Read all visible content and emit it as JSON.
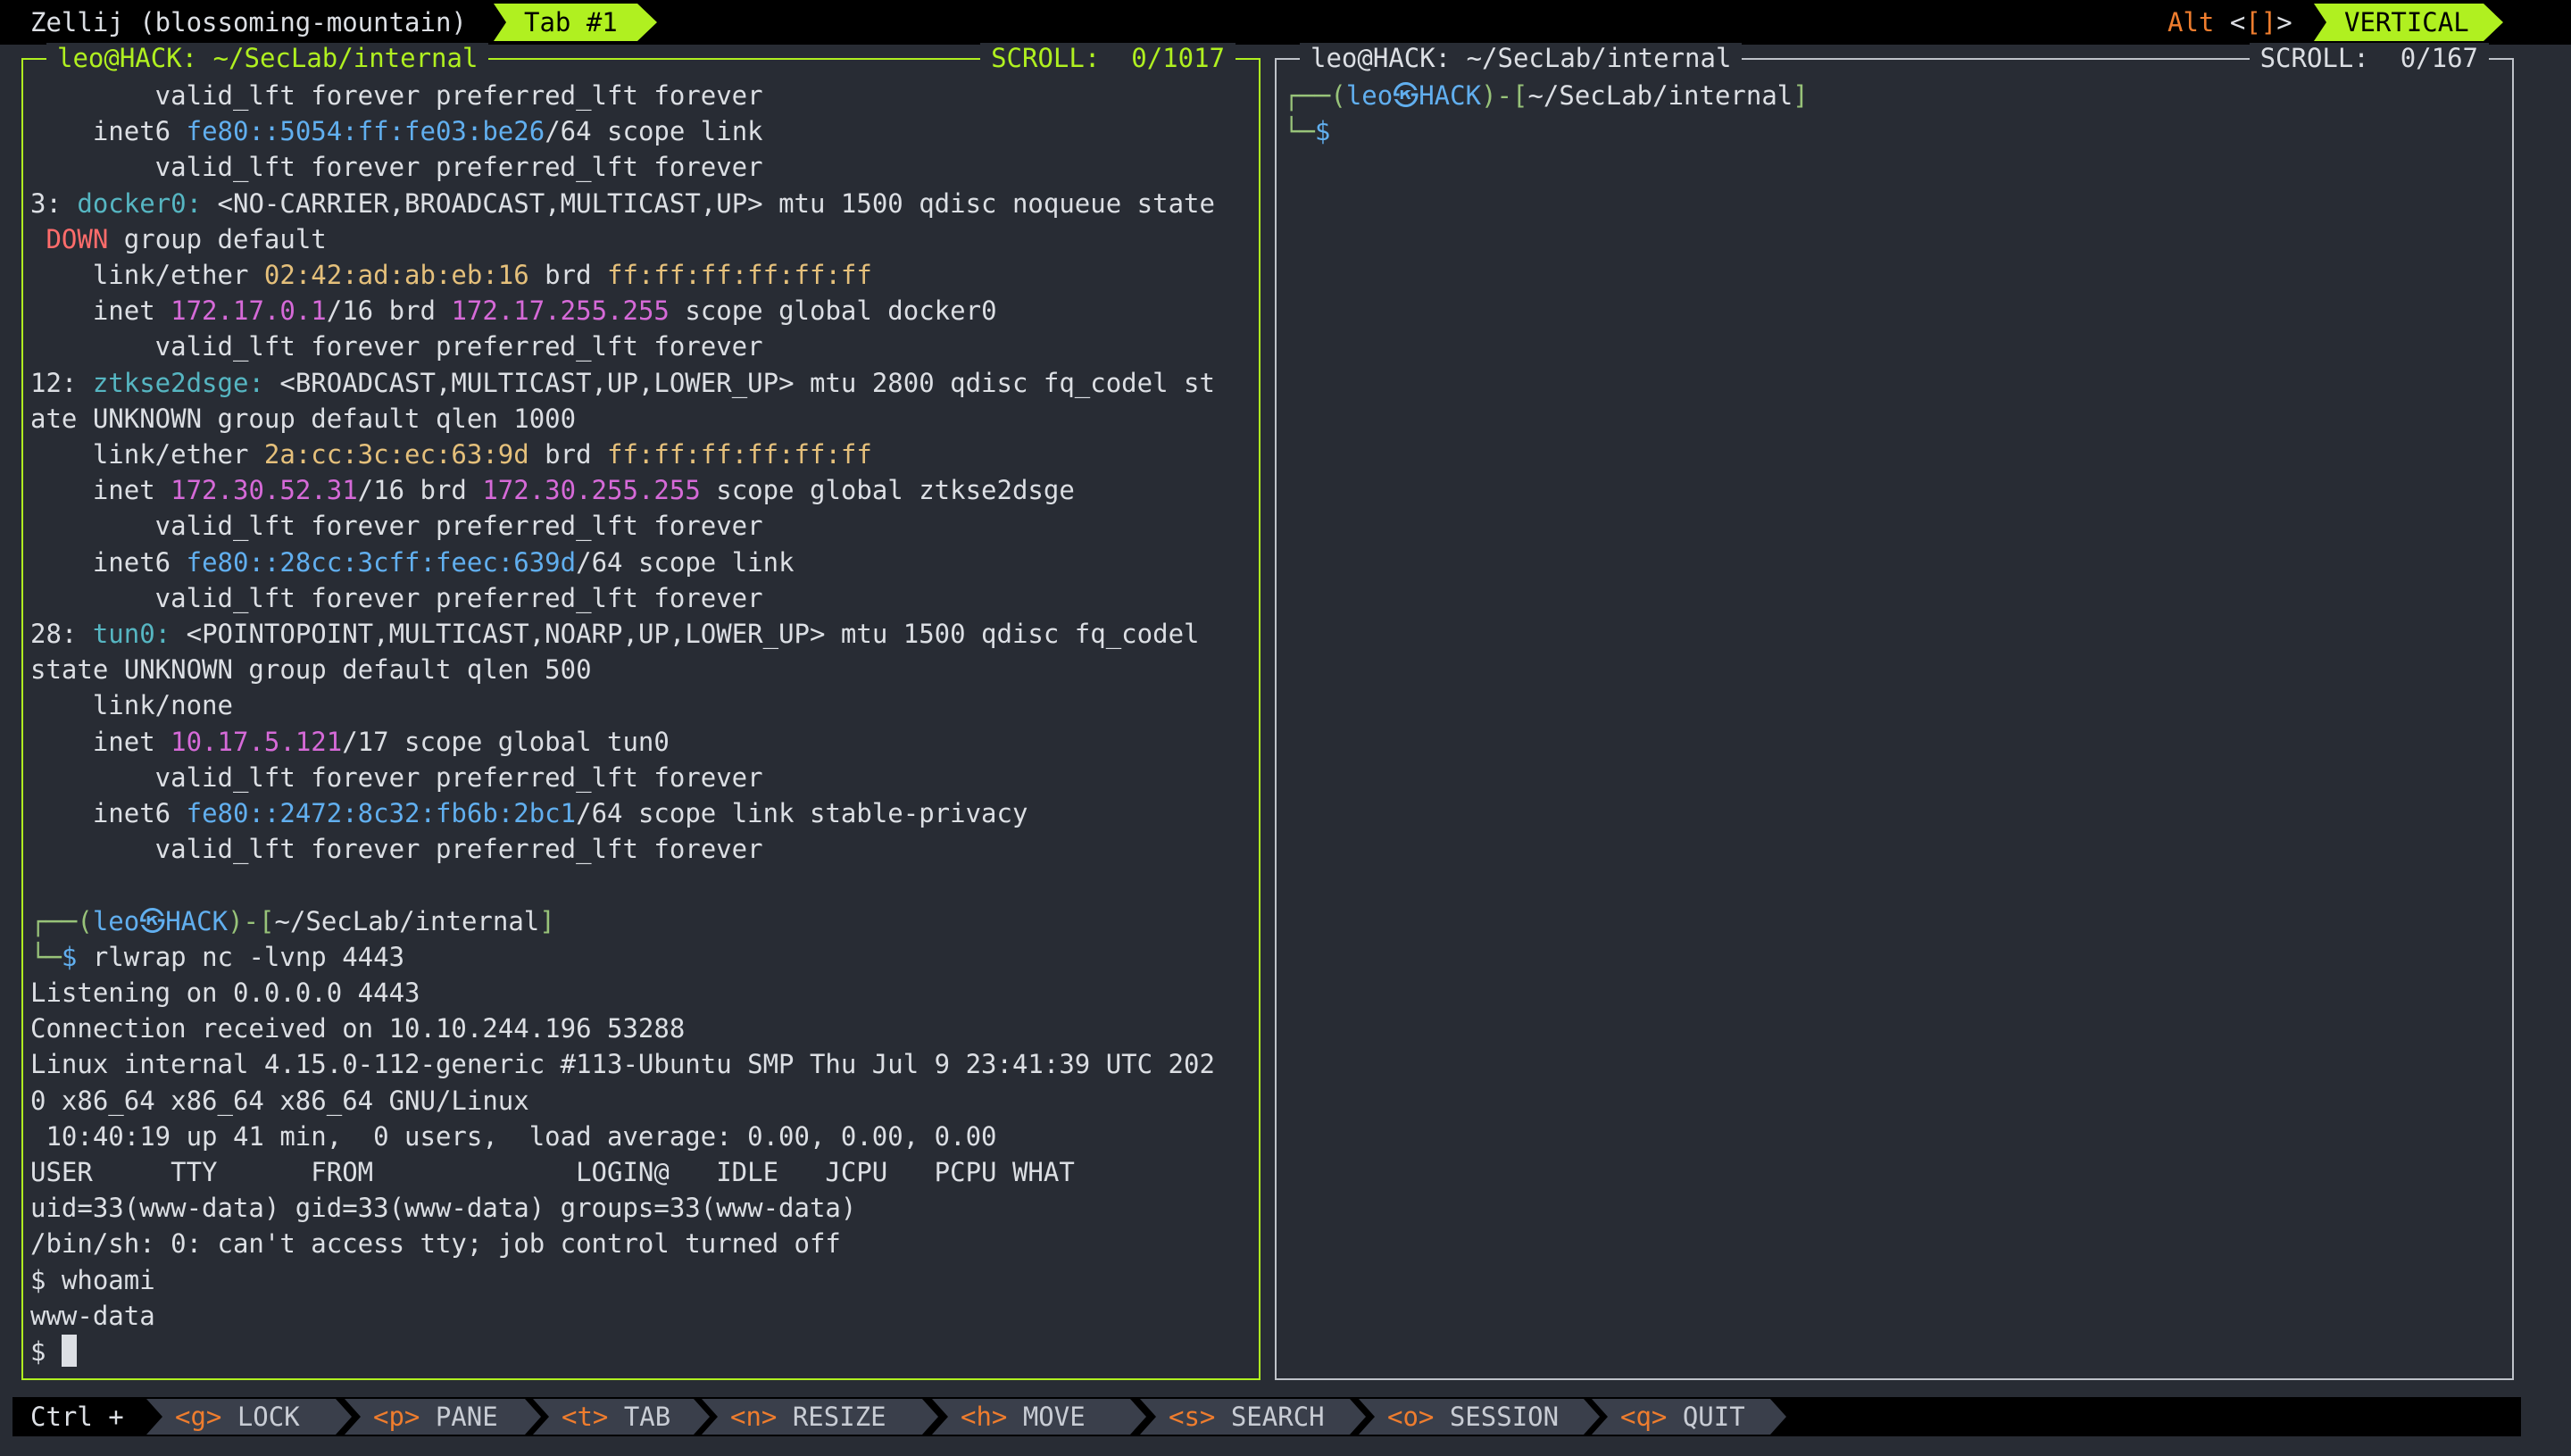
{
  "topbar": {
    "session": "Zellij (blossoming-mountain)",
    "tab": "Tab #1",
    "mode_alt": "Alt",
    "mode_lt": " <",
    "mode_brackets": "[]",
    "mode_gt": ">",
    "layout": "VERTICAL"
  },
  "left_pane": {
    "title": "leo@HACK: ~/SecLab/internal",
    "scroll": "SCROLL:  0/1017",
    "lines": [
      [
        {
          "t": "        valid_lft forever preferred_lft forever"
        }
      ],
      [
        {
          "t": "    inet6 "
        },
        {
          "t": "fe80::5054:ff:fe03:be26",
          "c": "c-blue"
        },
        {
          "t": "/64 scope link"
        }
      ],
      [
        {
          "t": "        valid_lft forever preferred_lft forever"
        }
      ],
      [
        {
          "t": "3: "
        },
        {
          "t": "docker0:",
          "c": "c-cyan"
        },
        {
          "t": " <NO-CARRIER,BROADCAST,MULTICAST,UP> mtu 1500 qdisc noqueue state"
        }
      ],
      [
        {
          "t": " "
        },
        {
          "t": "DOWN",
          "c": "c-red"
        },
        {
          "t": " group default"
        }
      ],
      [
        {
          "t": "    link/ether "
        },
        {
          "t": "02:42:ad:ab:eb:16",
          "c": "c-yel"
        },
        {
          "t": " brd "
        },
        {
          "t": "ff:ff:ff:ff:ff:ff",
          "c": "c-yel"
        }
      ],
      [
        {
          "t": "    inet "
        },
        {
          "t": "172.17.0.1",
          "c": "c-mag"
        },
        {
          "t": "/16 brd "
        },
        {
          "t": "172.17.255.255",
          "c": "c-mag"
        },
        {
          "t": " scope global docker0"
        }
      ],
      [
        {
          "t": "        valid_lft forever preferred_lft forever"
        }
      ],
      [
        {
          "t": "12: "
        },
        {
          "t": "ztkse2dsge:",
          "c": "c-cyan"
        },
        {
          "t": " <BROADCAST,MULTICAST,UP,LOWER_UP> mtu 2800 qdisc fq_codel st"
        }
      ],
      [
        {
          "t": "ate UNKNOWN group default qlen 1000"
        }
      ],
      [
        {
          "t": "    link/ether "
        },
        {
          "t": "2a:cc:3c:ec:63:9d",
          "c": "c-yel"
        },
        {
          "t": " brd "
        },
        {
          "t": "ff:ff:ff:ff:ff:ff",
          "c": "c-yel"
        }
      ],
      [
        {
          "t": "    inet "
        },
        {
          "t": "172.30.52.31",
          "c": "c-mag"
        },
        {
          "t": "/16 brd "
        },
        {
          "t": "172.30.255.255",
          "c": "c-mag"
        },
        {
          "t": " scope global ztkse2dsge"
        }
      ],
      [
        {
          "t": "        valid_lft forever preferred_lft forever"
        }
      ],
      [
        {
          "t": "    inet6 "
        },
        {
          "t": "fe80::28cc:3cff:feec:639d",
          "c": "c-blue"
        },
        {
          "t": "/64 scope link"
        }
      ],
      [
        {
          "t": "        valid_lft forever preferred_lft forever"
        }
      ],
      [
        {
          "t": "28: "
        },
        {
          "t": "tun0:",
          "c": "c-cyan"
        },
        {
          "t": " <POINTOPOINT,MULTICAST,NOARP,UP,LOWER_UP> mtu 1500 qdisc fq_codel"
        }
      ],
      [
        {
          "t": "state UNKNOWN group default qlen 500"
        }
      ],
      [
        {
          "t": "    link/none"
        }
      ],
      [
        {
          "t": "    inet "
        },
        {
          "t": "10.17.5.121",
          "c": "c-mag"
        },
        {
          "t": "/17 scope global tun0"
        }
      ],
      [
        {
          "t": "        valid_lft forever preferred_lft forever"
        }
      ],
      [
        {
          "t": "    inet6 "
        },
        {
          "t": "fe80::2472:8c32:fb6b:2bc1",
          "c": "c-blue"
        },
        {
          "t": "/64 scope link stable-privacy"
        }
      ],
      [
        {
          "t": "        valid_lft forever preferred_lft forever"
        }
      ],
      [
        {
          "t": ""
        }
      ],
      [
        {
          "t": "┌──(",
          "c": "c-green"
        },
        {
          "t": "leo㉿HACK",
          "c": "c-blue"
        },
        {
          "t": ")-[",
          "c": "c-green"
        },
        {
          "t": "~/SecLab/internal"
        },
        {
          "t": "]",
          "c": "c-green"
        }
      ],
      [
        {
          "t": "└─",
          "c": "c-green"
        },
        {
          "t": "$",
          "c": "c-blue"
        },
        {
          "t": " rlwrap nc -lvnp 4443"
        }
      ],
      [
        {
          "t": "Listening on 0.0.0.0 4443"
        }
      ],
      [
        {
          "t": "Connection received on 10.10.244.196 53288"
        }
      ],
      [
        {
          "t": "Linux internal 4.15.0-112-generic #113-Ubuntu SMP Thu Jul 9 23:41:39 UTC 202"
        }
      ],
      [
        {
          "t": "0 x86_64 x86_64 x86_64 GNU/Linux"
        }
      ],
      [
        {
          "t": " 10:40:19 up 41 min,  0 users,  load average: 0.00, 0.00, 0.00"
        }
      ],
      [
        {
          "t": "USER     TTY      FROM             LOGIN@   IDLE   JCPU   PCPU WHAT"
        }
      ],
      [
        {
          "t": "uid=33(www-data) gid=33(www-data) groups=33(www-data)"
        }
      ],
      [
        {
          "t": "/bin/sh: 0: can't access tty; job control turned off"
        }
      ],
      [
        {
          "t": "$ whoami"
        }
      ],
      [
        {
          "t": "www-data"
        }
      ],
      [
        {
          "t": "$ "
        },
        {
          "cursor": true
        }
      ]
    ]
  },
  "right_pane": {
    "title": "leo@HACK: ~/SecLab/internal",
    "scroll": "SCROLL:  0/167",
    "lines": [
      [
        {
          "t": "┌──(",
          "c": "c-green"
        },
        {
          "t": "leo㉿HACK",
          "c": "c-blue"
        },
        {
          "t": ")-[",
          "c": "c-green"
        },
        {
          "t": "~/SecLab/internal"
        },
        {
          "t": "]",
          "c": "c-green"
        }
      ],
      [
        {
          "t": "└─",
          "c": "c-green"
        },
        {
          "t": "$",
          "c": "c-blue"
        }
      ]
    ]
  },
  "bottombar": {
    "ctrl": "Ctrl +",
    "keys": [
      {
        "key": "<g>",
        "label": " LOCK"
      },
      {
        "key": "<p>",
        "label": " PANE"
      },
      {
        "key": "<t>",
        "label": " TAB"
      },
      {
        "key": "<n>",
        "label": " RESIZE"
      },
      {
        "key": "<h>",
        "label": " MOVE"
      },
      {
        "key": "<s>",
        "label": " SEARCH"
      },
      {
        "key": "<o>",
        "label": " SESSION"
      },
      {
        "key": "<q>",
        "label": " QUIT"
      }
    ]
  },
  "colors": {
    "accent": "#b0f020",
    "background": "#282c34",
    "bar": "#000000",
    "key_bg": "#3a3f4b",
    "key_letter": "#ef7d2e"
  }
}
